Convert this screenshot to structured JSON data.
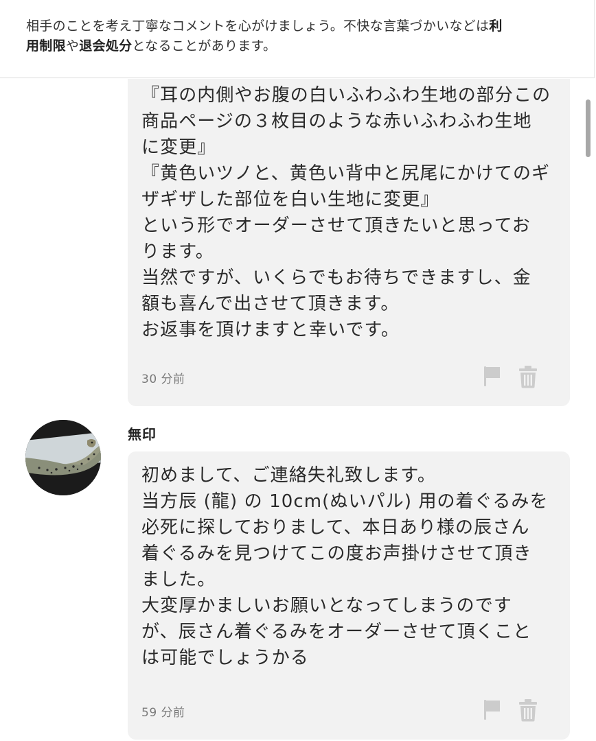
{
  "notice": {
    "segments": [
      {
        "text": "相手のことを考え丁寧なコメントを心がけましょう。不快な言葉づかいなどは",
        "bold": false
      },
      {
        "text": "利",
        "bold": true
      },
      {
        "break": true
      },
      {
        "text": "用制限",
        "bold": true
      },
      {
        "text": "や",
        "bold": false
      },
      {
        "text": "退会処分",
        "bold": true
      },
      {
        "text": "となることがあります。",
        "bold": false
      }
    ]
  },
  "comments": [
    {
      "lines": [
        "『耳の内側やお腹の白いふわふわ生地の部分この",
        "商品ページの３枚目のような赤いふわふわ生地",
        "に変更』",
        "『黄色いツノと、黄色い背中と尻尾にかけてのギ",
        "ザギザした部位を白い生地に変更』",
        "という形でオーダーさせて頂きたいと思ってお",
        "ります。",
        "当然ですが、いくらでもお待ちできますし、金",
        "額も喜んで出させて頂きます。",
        "お返事を頂けますと幸いです。"
      ],
      "time": "30 分前",
      "flag_icon": "flag-icon",
      "delete_icon": "trash-icon"
    },
    {
      "author": "無印",
      "avatar": "leopard-gecko-photo",
      "lines": [
        "初めまして、ご連絡失礼致します。",
        "当方辰 (龍) の 10cm(ぬいパル) 用の着ぐるみを",
        "必死に探しておりまして、本日あり様の辰さん",
        "着ぐるみを見つけてこの度お声掛けさせて頂き",
        "ました。",
        "大変厚かましいお願いとなってしまうのです",
        "が、辰さん着ぐるみをオーダーさせて頂くこと",
        "は可能でしょうかる"
      ],
      "time": "59 分前",
      "flag_icon": "flag-icon",
      "delete_icon": "trash-icon"
    }
  ],
  "colors": {
    "bubble": "#f2f2f2",
    "icon": "#cccccc",
    "timestamp": "#7a7a7a"
  }
}
